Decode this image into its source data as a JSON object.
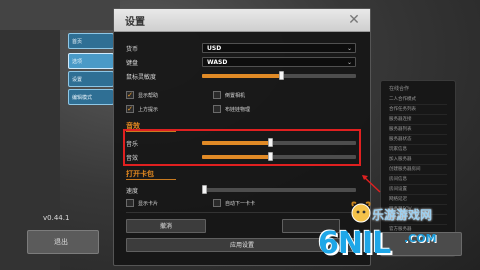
{
  "background": {
    "version": "v0.44.1",
    "left_tabs": [
      "首页",
      "选项",
      "设置",
      "编辑模式"
    ],
    "bottom_left_button": "退出",
    "right_panel": {
      "title": "在线合作",
      "rows": [
        "二人合作模式",
        "合作任务列表",
        "服务器连接",
        "服务器列表",
        "服务器状态",
        "玩家信息",
        "加入服务器",
        "创建服务器房间",
        "房间信息",
        "房间设置",
        "网络延迟",
        "服务器FOV",
        "联机帮助",
        "官方服务器"
      ]
    }
  },
  "dialog": {
    "title": "设置",
    "close_icon": "close-icon",
    "currency_label": "货币",
    "currency_value": "USD",
    "keyboard_label": "键盘",
    "keyboard_value": "WASD",
    "mouse_sensitivity_label": "鼠标灵敏度",
    "mouse_sensitivity": 0.51,
    "checkboxes": [
      {
        "label": "显示帮助",
        "checked": true
      },
      {
        "label": "倒置相机",
        "checked": false
      },
      {
        "label": "上方提示",
        "checked": true
      },
      {
        "label": "布娃娃物理",
        "checked": false
      }
    ],
    "sound_section": "音效",
    "music_label": "音乐",
    "music_level": 0.44,
    "sfx_label": "音效",
    "sfx_level": 0.44,
    "pack_section": "打开卡包",
    "speed_label": "速度",
    "speed_level": 0.0,
    "pack_checkboxes": [
      {
        "label": "显示卡片",
        "checked": false
      },
      {
        "label": "自动下一卡卡",
        "checked": false
      }
    ],
    "cancel_label": "撤消",
    "apply_label": "应用设置"
  },
  "watermark": {
    "site_name": "乐游游戏网",
    "logo": "6",
    "logo_rest": "NIL",
    "domain": ".COM"
  },
  "colors": {
    "accent": "#e08a26",
    "highlight_box": "#e02020",
    "tab_blue": "#2f6f94"
  }
}
